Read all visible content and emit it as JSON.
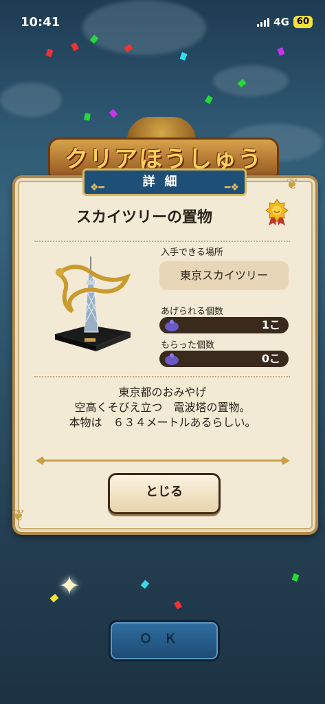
{
  "status_bar": {
    "time": "10:41",
    "network": "4G",
    "battery": "60"
  },
  "banner": {
    "title": "クリアほうしゅう"
  },
  "dialog": {
    "tab_title": "詳細",
    "item_name": "スカイツリーの置物",
    "location_label": "入手できる場所",
    "location_value": "東京スカイツリー",
    "giveable_label": "あげられる個数",
    "giveable_value": "1こ",
    "received_label": "もらった個数",
    "received_value": "0こ",
    "description": [
      "東京都のおみやげ",
      "空高くそびえ立つ　電波塔の置物。",
      "本物は　６３４メートルあるらしい。"
    ],
    "close_label": "とじる"
  },
  "footer": {
    "ok_label": "ＯＫ"
  },
  "colors": {
    "panel_bg": "#f3ead6",
    "tab_blue": "#1e4f76",
    "gold": "#d8b85c",
    "ok_blue": "#2f6ea0"
  },
  "icons": [
    "signal-icon",
    "battery-icon",
    "medal-icon",
    "bag-icon",
    "tower-ornament-image",
    "sparkle-icon"
  ]
}
